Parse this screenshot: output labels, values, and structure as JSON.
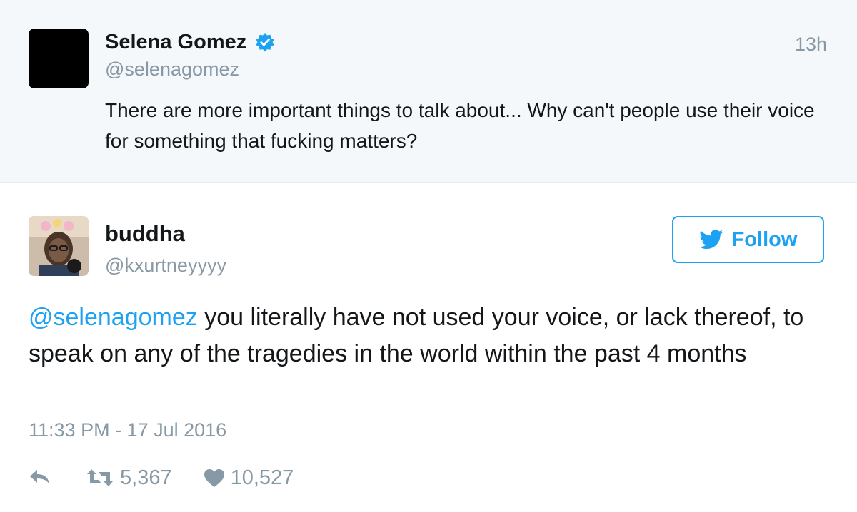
{
  "parent_tweet": {
    "author_name": "Selena Gomez",
    "author_handle": "@selenagomez",
    "verified": true,
    "time_ago": "13h",
    "text": "There are more important things to talk about... Why can't people use their voice for something that fucking matters?",
    "avatar_color": "#000000"
  },
  "main_tweet": {
    "author_name": "buddha",
    "author_handle": "@kxurtneyyyy",
    "follow_label": "Follow",
    "mention": "@selenagomez",
    "text": " you literally have not used your voice, or lack thereof, to speak on any of the tragedies in the world within the past 4 months",
    "timestamp": "11:33 PM - 17 Jul 2016",
    "actions": {
      "reply_icon": "reply-icon",
      "retweet_icon": "retweet-icon",
      "retweet_count": "5,367",
      "like_icon": "heart-icon",
      "like_count": "10,527"
    }
  },
  "colors": {
    "accent": "#1da1f2",
    "muted_text": "#8899a6",
    "primary_text": "#14171a",
    "parent_background": "#f5f8fa"
  }
}
